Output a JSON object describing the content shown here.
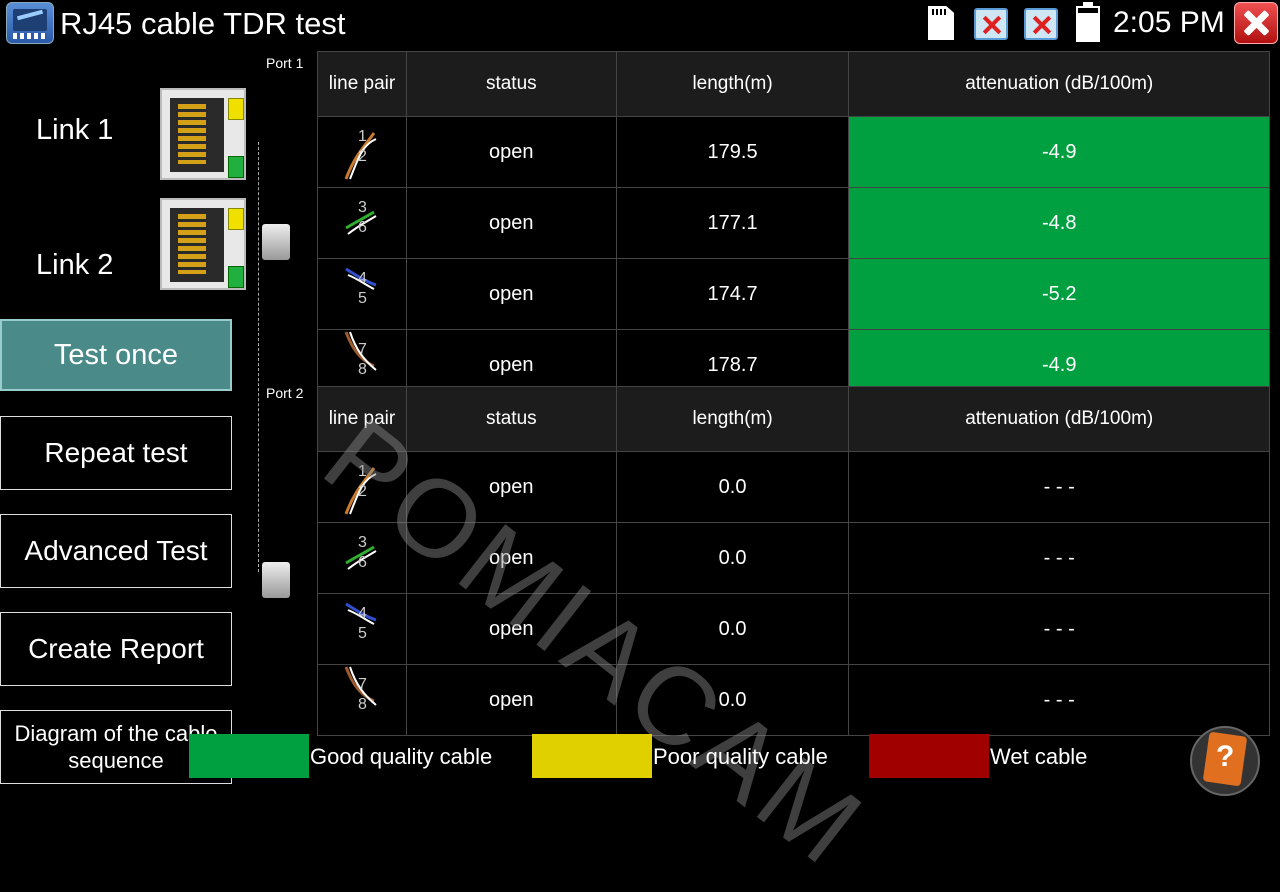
{
  "titlebar": {
    "title": "RJ45 cable TDR test",
    "time": "2:05 PM"
  },
  "left": {
    "link1": "Link 1",
    "link2": "Link 2",
    "buttons": {
      "test_once": "Test once",
      "repeat_test": "Repeat test",
      "advanced_test": "Advanced Test",
      "create_report": "Create Report",
      "diagram": "Diagram of the cable sequence"
    }
  },
  "ports": [
    {
      "label": "Port 1",
      "headers": [
        "line pair",
        "status",
        "length(m)",
        "attenuation (dB/100m)"
      ],
      "rows": [
        {
          "pair_top": "1",
          "pair_bottom": "2",
          "status": "open",
          "length": "179.5",
          "attenuation": "-4.9",
          "quality": "good"
        },
        {
          "pair_top": "3",
          "pair_bottom": "6",
          "status": "open",
          "length": "177.1",
          "attenuation": "-4.8",
          "quality": "good"
        },
        {
          "pair_top": "4",
          "pair_bottom": "5",
          "status": "open",
          "length": "174.7",
          "attenuation": "-5.2",
          "quality": "good"
        },
        {
          "pair_top": "7",
          "pair_bottom": "8",
          "status": "open",
          "length": "178.7",
          "attenuation": "-4.9",
          "quality": "good"
        }
      ]
    },
    {
      "label": "Port 2",
      "headers": [
        "line pair",
        "status",
        "length(m)",
        "attenuation (dB/100m)"
      ],
      "rows": [
        {
          "pair_top": "1",
          "pair_bottom": "2",
          "status": "open",
          "length": "0.0",
          "attenuation": "- - -"
        },
        {
          "pair_top": "3",
          "pair_bottom": "6",
          "status": "open",
          "length": "0.0",
          "attenuation": "- - -"
        },
        {
          "pair_top": "4",
          "pair_bottom": "5",
          "status": "open",
          "length": "0.0",
          "attenuation": "- - -"
        },
        {
          "pair_top": "7",
          "pair_bottom": "8",
          "status": "open",
          "length": "0.0",
          "attenuation": "- - -"
        }
      ]
    }
  ],
  "watermark": "POMIACAM",
  "legend": [
    {
      "label": "Good quality cable",
      "color": "#00a040"
    },
    {
      "label": "Poor quality cable",
      "color": "#e0d000"
    },
    {
      "label": "Wet cable",
      "color": "#a00000"
    }
  ],
  "colors": {
    "good": "#00a040",
    "accent_button": "#4a8a88"
  },
  "wire_colors": [
    "#c87a30",
    "#30b030",
    "#3050d0",
    "#a05a30"
  ],
  "icons": [
    "sd-card-icon",
    "network-disconnected-icon",
    "network-disconnected-icon",
    "battery-icon",
    "close-icon",
    "help-book-icon"
  ]
}
